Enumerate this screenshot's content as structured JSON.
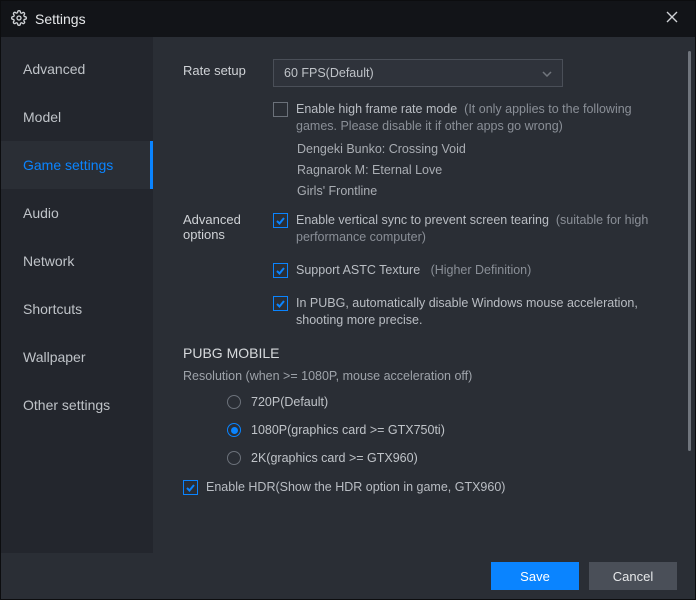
{
  "window": {
    "title": "Settings"
  },
  "sidebar": {
    "items": [
      {
        "label": "Advanced"
      },
      {
        "label": "Model"
      },
      {
        "label": "Game settings"
      },
      {
        "label": "Audio"
      },
      {
        "label": "Network"
      },
      {
        "label": "Shortcuts"
      },
      {
        "label": "Wallpaper"
      },
      {
        "label": "Other settings"
      }
    ],
    "active_index": 2
  },
  "rate_setup": {
    "label": "Rate setup",
    "selected": "60 FPS(Default)",
    "hfr_checkbox": {
      "checked": false,
      "text": "Enable high frame rate mode",
      "note": "(It only applies to the following games. Please disable it if other apps go wrong)"
    },
    "hfr_games": [
      "Dengeki Bunko: Crossing Void",
      "Ragnarok M: Eternal Love",
      "Girls' Frontline"
    ]
  },
  "advanced_options": {
    "label": "Advanced options",
    "vsync": {
      "checked": true,
      "text": "Enable vertical sync to prevent screen tearing",
      "note": "(suitable for high performance computer)"
    },
    "astc": {
      "checked": true,
      "text": "Support ASTC Texture",
      "note": "(Higher Definition)"
    },
    "pubg_mouse": {
      "checked": true,
      "text": "In PUBG, automatically disable Windows mouse acceleration, shooting more precise."
    }
  },
  "pubg_mobile": {
    "heading": "PUBG MOBILE",
    "resolution_caption": "Resolution (when >= 1080P, mouse acceleration off)",
    "resolution_options": [
      {
        "label": "720P(Default)",
        "checked": false
      },
      {
        "label": "1080P(graphics card >= GTX750ti)",
        "checked": true
      },
      {
        "label": "2K(graphics card >= GTX960)",
        "checked": false
      }
    ],
    "hdr": {
      "checked": true,
      "text": "Enable HDR(Show the HDR option in game, GTX960)"
    }
  },
  "footer": {
    "save": "Save",
    "cancel": "Cancel"
  }
}
